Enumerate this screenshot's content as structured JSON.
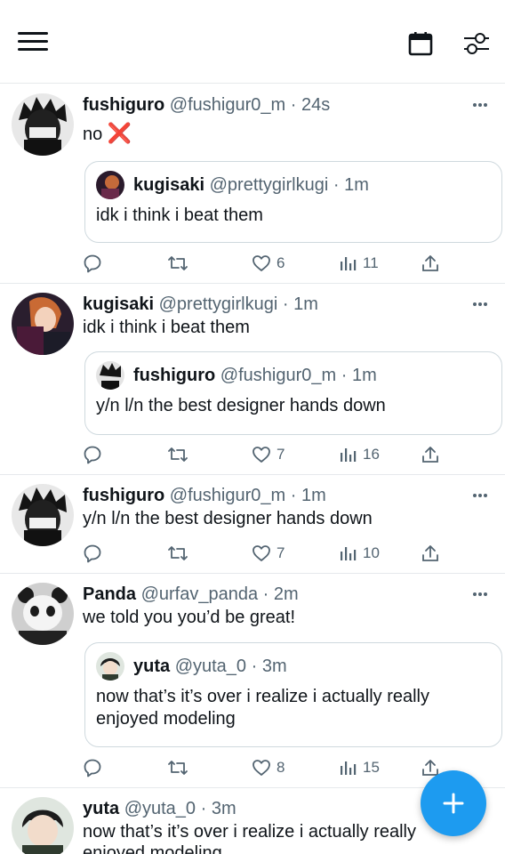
{
  "header": {
    "menu_icon": "hamburger-icon",
    "calendar_icon": "calendar-icon",
    "filter_icon": "sliders-icon"
  },
  "tweets": [
    {
      "name": "fushiguro",
      "handle": "@fushigur0_m",
      "dot": "·",
      "time": "24s",
      "text": "no",
      "emoji": "❌",
      "quote": {
        "name": "kugisaki",
        "handle": "@prettygirlkugi",
        "dot": "·",
        "time": "1m",
        "text": "idk i think i beat them"
      },
      "likes": "6",
      "views": "11"
    },
    {
      "name": "kugisaki",
      "handle": "@prettygirlkugi",
      "dot": "·",
      "time": "1m",
      "text": "idk i think i beat them",
      "quote": {
        "name": "fushiguro",
        "handle": "@fushigur0_m",
        "dot": "·",
        "time": "1m",
        "text": "y/n l/n the best designer hands down"
      },
      "likes": "7",
      "views": "16"
    },
    {
      "name": "fushiguro",
      "handle": "@fushigur0_m",
      "dot": "·",
      "time": "1m",
      "text": "y/n l/n the best designer hands down",
      "likes": "7",
      "views": "10"
    },
    {
      "name": "Panda",
      "handle": "@urfav_panda",
      "dot": "·",
      "time": "2m",
      "text": "we told you you’d be great!",
      "quote": {
        "name": "yuta",
        "handle": "@yuta_0",
        "dot": "·",
        "time": "3m",
        "text": "now that’s it’s over i realize i actually really enjoyed modeling"
      },
      "likes": "8",
      "views": "15"
    },
    {
      "name": "yuta",
      "handle": "@yuta_0",
      "dot": "·",
      "time": "3m",
      "text": "now that’s it’s over i realize i actually really enjoyed modeling"
    }
  ],
  "fab": {
    "icon": "plus-icon"
  },
  "colors": {
    "accent": "#1d9bf0",
    "text": "#0f1419",
    "muted": "#536471",
    "border": "#cfd9de",
    "alert": "#e0202e"
  }
}
